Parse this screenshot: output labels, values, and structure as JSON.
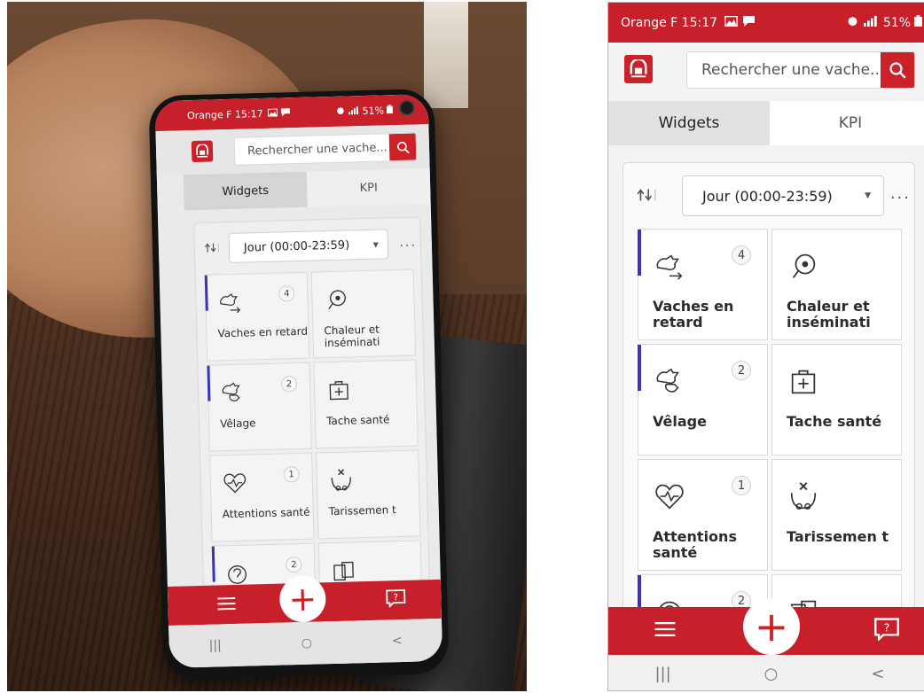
{
  "status_bar": {
    "carrier_time": "Orange F 15:17",
    "battery": "51%"
  },
  "search": {
    "placeholder": "Rechercher une vache..."
  },
  "tabs": [
    {
      "label": "Widgets",
      "active": true
    },
    {
      "label": "KPI",
      "active": false
    }
  ],
  "period_select": {
    "value": "Jour (00:00-23:59)"
  },
  "more_menu": "...",
  "tiles": [
    {
      "label": "Vaches en retard",
      "badge": "4",
      "icon": "cow-arrow-icon",
      "flagged": true
    },
    {
      "label": "Chaleur et inséminati",
      "badge": "",
      "icon": "insemination-icon",
      "flagged": false
    },
    {
      "label": "Vêlage",
      "badge": "2",
      "icon": "calving-icon",
      "flagged": true
    },
    {
      "label": "Tache santé",
      "badge": "",
      "icon": "health-kit-icon",
      "flagged": false
    },
    {
      "label": "Attentions santé",
      "badge": "1",
      "icon": "heart-pulse-icon",
      "flagged": false
    },
    {
      "label": "Tarissemen t",
      "badge": "",
      "icon": "dry-off-udder-icon",
      "flagged": false
    },
    {
      "label": "",
      "badge": "2",
      "icon": "question-icon",
      "flagged": true
    },
    {
      "label": "",
      "badge": "",
      "icon": "cards-icon",
      "flagged": false
    }
  ],
  "bottom_bar": {
    "menu_icon": "menu-icon",
    "add_icon": "plus-icon",
    "help_icon": "help-chat-icon",
    "add_symbol": "+"
  },
  "nav_bar": {
    "recent": "|||",
    "home": "○",
    "back": "<"
  },
  "colors": {
    "brand_red": "#c8202a",
    "flag_blue": "#3b32b8"
  }
}
